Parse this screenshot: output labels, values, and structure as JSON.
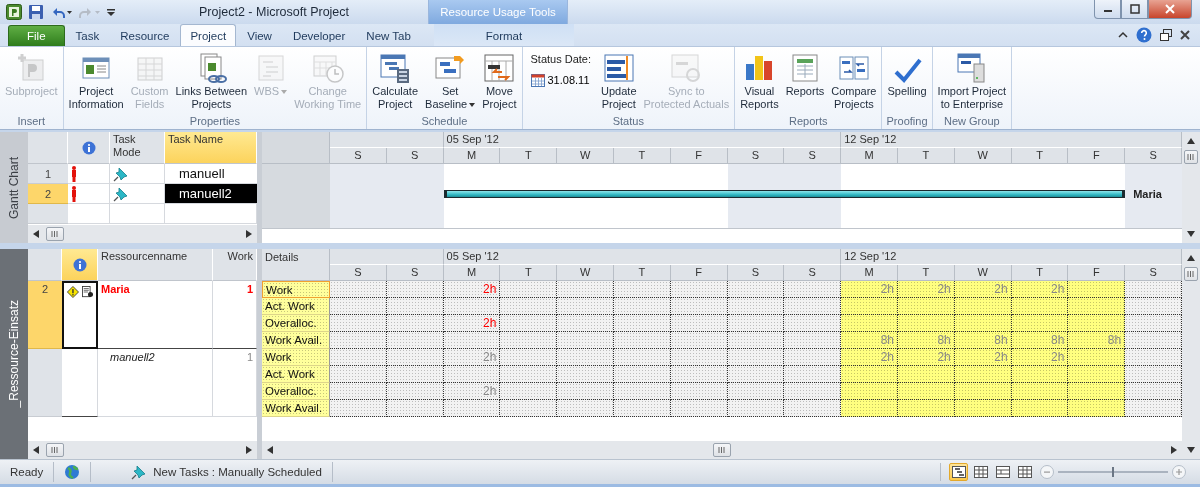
{
  "window": {
    "title": "Project2 - Microsoft Project"
  },
  "ribbon_tabs": [
    {
      "kind": "file",
      "label": "File",
      "selected": false
    },
    {
      "kind": "tab",
      "label": "Task",
      "selected": false
    },
    {
      "kind": "tab",
      "label": "Resource",
      "selected": false
    },
    {
      "kind": "tab",
      "label": "Project",
      "selected": true
    },
    {
      "kind": "tab",
      "label": "View",
      "selected": false
    },
    {
      "kind": "tab",
      "label": "Developer",
      "selected": false
    },
    {
      "kind": "tab",
      "label": "New Tab",
      "selected": false
    }
  ],
  "contextual": {
    "title": "Resource Usage Tools",
    "tabs": [
      {
        "label": "Format",
        "selected": false
      }
    ]
  },
  "ribbon_groups": [
    {
      "label": "Insert",
      "items": [
        {
          "kind": "button",
          "lines": [
            "Subproject"
          ],
          "disabled": true
        }
      ]
    },
    {
      "label": "Properties",
      "items": [
        {
          "kind": "button",
          "lines": [
            "Project",
            "Information"
          ],
          "disabled": false
        },
        {
          "kind": "button",
          "lines": [
            "Custom",
            "Fields"
          ],
          "disabled": true
        },
        {
          "kind": "button",
          "lines": [
            "Links Between",
            "Projects"
          ],
          "disabled": false
        },
        {
          "kind": "button",
          "lines": [
            "WBS"
          ],
          "disabled": true,
          "dropdown": true
        },
        {
          "kind": "button",
          "lines": [
            "Change",
            "Working Time"
          ],
          "disabled": true
        }
      ]
    },
    {
      "label": "Schedule",
      "items": [
        {
          "kind": "button",
          "lines": [
            "Calculate",
            "Project"
          ],
          "disabled": false
        },
        {
          "kind": "button",
          "lines": [
            "Set",
            "Baseline"
          ],
          "disabled": false,
          "dropdown": true
        },
        {
          "kind": "button",
          "lines": [
            "Move",
            "Project"
          ],
          "disabled": false
        }
      ]
    },
    {
      "label": "Status",
      "items": [
        {
          "kind": "date",
          "label": "Status Date:",
          "value": "31.08.11"
        },
        {
          "kind": "button",
          "lines": [
            "Update",
            "Project"
          ],
          "disabled": false
        },
        {
          "kind": "button",
          "lines": [
            "Sync to",
            "Protected Actuals"
          ],
          "disabled": true
        }
      ]
    },
    {
      "label": "Reports",
      "items": [
        {
          "kind": "button",
          "lines": [
            "Visual",
            "Reports"
          ],
          "disabled": false
        },
        {
          "kind": "button",
          "lines": [
            "Reports"
          ],
          "disabled": false
        },
        {
          "kind": "button",
          "lines": [
            "Compare",
            "Projects"
          ],
          "disabled": false
        }
      ]
    },
    {
      "label": "Proofing",
      "items": [
        {
          "kind": "button",
          "lines": [
            "Spelling"
          ],
          "disabled": false
        }
      ]
    },
    {
      "label": "New Group",
      "items": [
        {
          "kind": "button",
          "lines": [
            "Import Project",
            "to Enterprise"
          ],
          "disabled": false
        }
      ]
    }
  ],
  "gantt": {
    "view_label": "Gantt Chart",
    "columns": [
      {
        "kind": "info",
        "selected": false
      },
      {
        "kind": "text",
        "label": "Task Mode",
        "selected": false
      },
      {
        "kind": "text",
        "label": "Task Name",
        "selected": true
      }
    ],
    "tasks": [
      {
        "id": "1",
        "name": "manuell",
        "selected": false
      },
      {
        "id": "2",
        "name": "manuell2",
        "selected": true,
        "bar": {
          "label": "Maria",
          "days": [
            false,
            false,
            true,
            true,
            true,
            true,
            true,
            true,
            true,
            true,
            true,
            true,
            true,
            true,
            false
          ]
        }
      }
    ],
    "timescale": [
      {
        "days": [
          {
            "label": "S",
            "nonworking": true
          },
          {
            "label": "S",
            "nonworking": true
          }
        ]
      },
      {
        "label": "05 Sep '12",
        "days": [
          {
            "label": "M",
            "nonworking": false
          },
          {
            "label": "T",
            "nonworking": false
          },
          {
            "label": "W",
            "nonworking": false
          },
          {
            "label": "T",
            "nonworking": false
          },
          {
            "label": "F",
            "nonworking": false
          },
          {
            "label": "S",
            "nonworking": true
          },
          {
            "label": "S",
            "nonworking": true
          }
        ]
      },
      {
        "label": "12 Sep '12",
        "days": [
          {
            "label": "M",
            "nonworking": false
          },
          {
            "label": "T",
            "nonworking": false
          },
          {
            "label": "W",
            "nonworking": false
          },
          {
            "label": "T",
            "nonworking": false
          },
          {
            "label": "F",
            "nonworking": false
          },
          {
            "label": "S",
            "nonworking": true
          }
        ]
      }
    ]
  },
  "usage": {
    "view_label": "_Ressource-Einsatz",
    "details_header": "Details",
    "columns": [
      {
        "kind": "info",
        "selected": true
      },
      {
        "kind": "text",
        "label": "Ressourcenname",
        "selected": false
      },
      {
        "kind": "number",
        "label": "Work",
        "selected": false
      }
    ],
    "timescale": [
      {
        "days": [
          {
            "label": "S",
            "selected": false
          },
          {
            "label": "S",
            "selected": false
          }
        ]
      },
      {
        "label": "05 Sep '12",
        "days": [
          {
            "label": "M",
            "selected": false
          },
          {
            "label": "T",
            "selected": false
          },
          {
            "label": "W",
            "selected": false
          },
          {
            "label": "T",
            "selected": false
          },
          {
            "label": "F",
            "selected": false
          },
          {
            "label": "S",
            "selected": false
          },
          {
            "label": "S",
            "selected": false
          }
        ]
      },
      {
        "label": "12 Sep '12",
        "days": [
          {
            "label": "M",
            "selected": true
          },
          {
            "label": "T",
            "selected": true
          },
          {
            "label": "W",
            "selected": true
          },
          {
            "label": "T",
            "selected": true
          },
          {
            "label": "F",
            "selected": true
          },
          {
            "label": "S",
            "selected": false
          }
        ]
      }
    ],
    "entries": [
      {
        "kind": "resource",
        "id": "2",
        "name": "Maria",
        "work": "1",
        "overallocated": true,
        "selected": true,
        "rows": [
          {
            "label": "Work",
            "cells": [
              null,
              null,
              {
                "text": "2h",
                "overallocated": true
              },
              null,
              null,
              null,
              null,
              null,
              null,
              {
                "text": "2h",
                "overallocated": false
              },
              {
                "text": "2h",
                "overallocated": false
              },
              {
                "text": "2h",
                "overallocated": false
              },
              {
                "text": "2h",
                "overallocated": false
              },
              null,
              null
            ]
          },
          {
            "label": "Act. Work",
            "cells": [
              null,
              null,
              null,
              null,
              null,
              null,
              null,
              null,
              null,
              null,
              null,
              null,
              null,
              null,
              null
            ]
          },
          {
            "label": "Overalloc.",
            "cells": [
              null,
              null,
              {
                "text": "2h",
                "overallocated": true
              },
              null,
              null,
              null,
              null,
              null,
              null,
              null,
              null,
              null,
              null,
              null,
              null
            ]
          },
          {
            "label": "Work Avail.",
            "cells": [
              null,
              null,
              null,
              null,
              null,
              null,
              null,
              null,
              null,
              {
                "text": "8h",
                "overallocated": false
              },
              {
                "text": "8h",
                "overallocated": false
              },
              {
                "text": "8h",
                "overallocated": false
              },
              {
                "text": "8h",
                "overallocated": false
              },
              {
                "text": "8h",
                "overallocated": false
              },
              null
            ]
          }
        ]
      },
      {
        "kind": "assignment",
        "name": "manuell2",
        "work": "1",
        "overallocated": false,
        "selected": false,
        "rows": [
          {
            "label": "Work",
            "cells": [
              null,
              null,
              {
                "text": "2h",
                "overallocated": false
              },
              null,
              null,
              null,
              null,
              null,
              null,
              {
                "text": "2h",
                "overallocated": false
              },
              {
                "text": "2h",
                "overallocated": false
              },
              {
                "text": "2h",
                "overallocated": false
              },
              {
                "text": "2h",
                "overallocated": false
              },
              null,
              null
            ]
          },
          {
            "label": "Act. Work",
            "cells": [
              null,
              null,
              null,
              null,
              null,
              null,
              null,
              null,
              null,
              null,
              null,
              null,
              null,
              null,
              null
            ]
          },
          {
            "label": "Overalloc.",
            "cells": [
              null,
              null,
              {
                "text": "2h",
                "overallocated": false
              },
              null,
              null,
              null,
              null,
              null,
              null,
              null,
              null,
              null,
              null,
              null,
              null
            ]
          },
          {
            "label": "Work Avail.",
            "cells": [
              null,
              null,
              null,
              null,
              null,
              null,
              null,
              null,
              null,
              null,
              null,
              null,
              null,
              null,
              null
            ]
          }
        ]
      }
    ]
  },
  "status_bar": {
    "items": [
      {
        "kind": "text",
        "label": "Ready"
      },
      {
        "kind": "globe"
      },
      {
        "kind": "pin",
        "label": "New Tasks : Manually Scheduled"
      }
    ],
    "views": [
      {
        "selected": true
      },
      {
        "selected": false
      },
      {
        "selected": false
      },
      {
        "selected": false
      }
    ],
    "zoom": {
      "level": 0.5
    }
  }
}
